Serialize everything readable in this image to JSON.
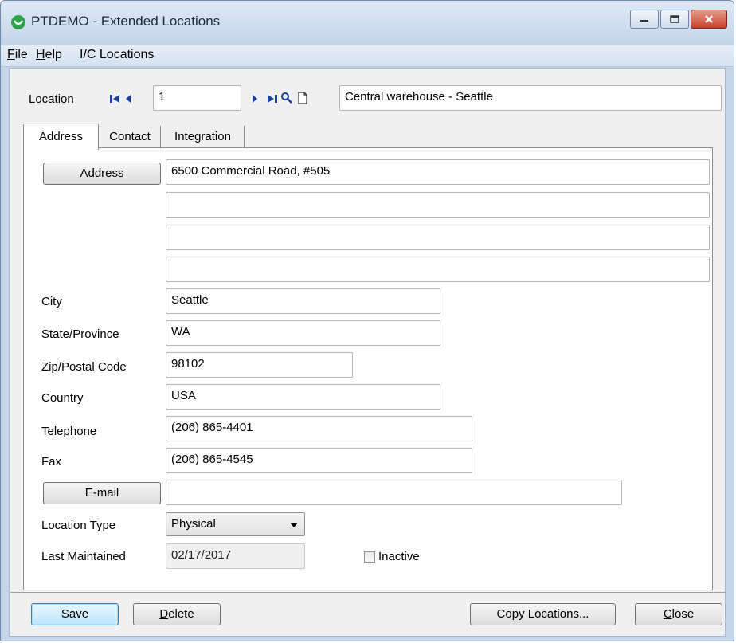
{
  "window": {
    "title": "PTDEMO - Extended Locations",
    "buttons": {
      "minimize": "minimize-icon",
      "maximize": "maximize-icon",
      "close": "close-icon"
    }
  },
  "menu": [
    "File",
    "Help",
    "I/C Locations"
  ],
  "menu_underline": [
    "F",
    "H",
    ""
  ],
  "location": {
    "label": "Location",
    "value": "1",
    "description": "Central warehouse - Seattle"
  },
  "tabs": [
    "Address",
    "Contact",
    "Integration"
  ],
  "address": {
    "button_label": "Address",
    "line1": "6500 Commercial Road, #505",
    "line2": "",
    "line3": "",
    "line4": ""
  },
  "fields": {
    "city_label": "City",
    "city": "Seattle",
    "state_label": "State/Province",
    "state": "WA",
    "zip_label": "Zip/Postal Code",
    "zip": "98102",
    "country_label": "Country",
    "country": "USA",
    "telephone_label": "Telephone",
    "telephone": "(206) 865-4401",
    "fax_label": "Fax",
    "fax": "(206) 865-4545",
    "email_button": "E-mail",
    "email": "",
    "location_type_label": "Location Type",
    "location_type": "Physical",
    "last_maintained_label": "Last Maintained",
    "last_maintained": "02/17/2017",
    "inactive_label": "Inactive"
  },
  "footer": {
    "save": "Save",
    "delete": "Delete",
    "copy": "Copy Locations...",
    "close": "Close"
  },
  "colors": {
    "titlebar": "#c3d4e9",
    "close_button": "#c8412b",
    "default_button": "#bee6fd",
    "app_icon": "#2fa34a"
  }
}
